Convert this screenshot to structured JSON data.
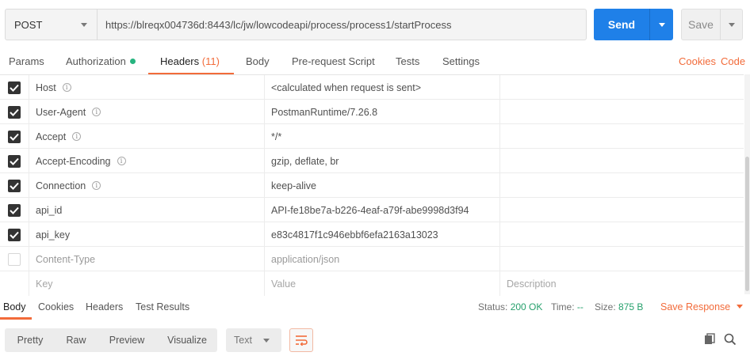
{
  "request": {
    "method": "POST",
    "url": "https://blreqx004736d:8443/lc/jw/lowcodeapi/process/process1/startProcess",
    "send_label": "Send",
    "save_label": "Save"
  },
  "tabs": [
    {
      "label": "Params"
    },
    {
      "label": "Authorization"
    },
    {
      "label": "Headers",
      "count": "(11)"
    },
    {
      "label": "Body"
    },
    {
      "label": "Pre-request Script"
    },
    {
      "label": "Tests"
    },
    {
      "label": "Settings"
    }
  ],
  "links": {
    "cookies": "Cookies",
    "code": "Code"
  },
  "headers": [
    {
      "key": "Host",
      "value": "<calculated when request is sent>",
      "checked": true,
      "info": true
    },
    {
      "key": "User-Agent",
      "value": "PostmanRuntime/7.26.8",
      "checked": true,
      "info": true
    },
    {
      "key": "Accept",
      "value": "*/*",
      "checked": true,
      "info": true
    },
    {
      "key": "Accept-Encoding",
      "value": "gzip, deflate, br",
      "checked": true,
      "info": true
    },
    {
      "key": "Connection",
      "value": "keep-alive",
      "checked": true,
      "info": true
    },
    {
      "key": "api_id",
      "value": "API-fe18be7a-b226-4eaf-a79f-abe9998d3f94",
      "checked": true,
      "info": false
    },
    {
      "key": "api_key",
      "value": "e83c4817f1c946ebbf6efa2163a13023",
      "checked": true,
      "info": false
    },
    {
      "key": "Content-Type",
      "value": "application/json",
      "checked": false,
      "info": false
    }
  ],
  "new_row": {
    "key_placeholder": "Key",
    "value_placeholder": "Value",
    "desc_placeholder": "Description"
  },
  "response": {
    "tabs": [
      "Body",
      "Cookies",
      "Headers",
      "Test Results"
    ],
    "status_label": "Status:",
    "status_value": "200 OK",
    "time_label": "Time:",
    "time_value": "--",
    "size_label": "Size:",
    "size_value": "875 B",
    "save_response": "Save Response",
    "views": [
      "Pretty",
      "Raw",
      "Preview",
      "Visualize"
    ],
    "format": "Text"
  },
  "colors": {
    "accent": "#f26b3a",
    "send": "#1f80e8",
    "success": "#26a06c"
  }
}
